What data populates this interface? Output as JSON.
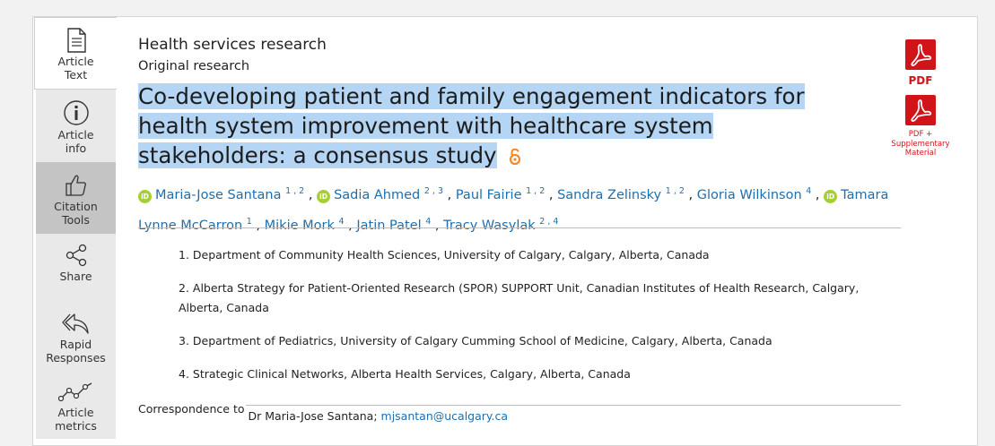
{
  "sidebar": {
    "items": [
      {
        "label": "Article Text",
        "icon": "document-icon"
      },
      {
        "label": "Article info",
        "icon": "info-icon"
      },
      {
        "label": "Citation Tools",
        "icon": "thumbs-up-icon"
      },
      {
        "label": "Share",
        "icon": "share-icon"
      },
      {
        "label": "Rapid Responses",
        "icon": "reply-icon"
      },
      {
        "label": "Article metrics",
        "icon": "metrics-icon"
      }
    ]
  },
  "article": {
    "section": "Health services research",
    "subsection": "Original research",
    "title": "Co-developing patient and family engagement indicators for health system improvement with healthcare system stakeholders: a consensus study",
    "authors": [
      {
        "name": "Maria-Jose Santana",
        "affils": "1 , 2",
        "orcid": true
      },
      {
        "name": "Sadia Ahmed",
        "affils": "2 , 3",
        "orcid": true
      },
      {
        "name": "Paul Fairie",
        "affils": "1 , 2",
        "orcid": false
      },
      {
        "name": "Sandra Zelinsky",
        "affils": "1 , 2",
        "orcid": false
      },
      {
        "name": "Gloria Wilkinson",
        "affils": "4",
        "orcid": false
      },
      {
        "name": "Tamara Lynne McCarron",
        "affils": "1",
        "orcid": true
      },
      {
        "name": "Mikie Mork",
        "affils": "4",
        "orcid": false
      },
      {
        "name": "Jatin Patel",
        "affils": "4",
        "orcid": false
      },
      {
        "name": "Tracy Wasylak",
        "affils": "2 , 4",
        "orcid": false
      }
    ],
    "affiliations": [
      "1. Department of Community Health Sciences, University of Calgary, Calgary, Alberta, Canada",
      "2. Alberta Strategy for Patient-Oriented Research (SPOR) SUPPORT Unit, Canadian Institutes of Health Research, Calgary, Alberta, Canada",
      "3. Department of Pediatrics, University of Calgary Cumming School of Medicine, Calgary, Alberta, Canada",
      "4. Strategic Clinical Networks, Alberta Health Services, Calgary, Alberta, Canada"
    ],
    "correspondence_label": "Correspondence to",
    "correspondence_name": "Dr Maria-Jose Santana;",
    "correspondence_email": "mjsantan@ucalgary.ca"
  },
  "downloads": {
    "pdf_label": "PDF",
    "pdf_supp_label": "PDF + Supplementary Material"
  },
  "colors": {
    "link": "#1f6eab",
    "pdf_red": "#d0141a",
    "highlight": "#b5d5f4",
    "orcid": "#a6ce39"
  }
}
